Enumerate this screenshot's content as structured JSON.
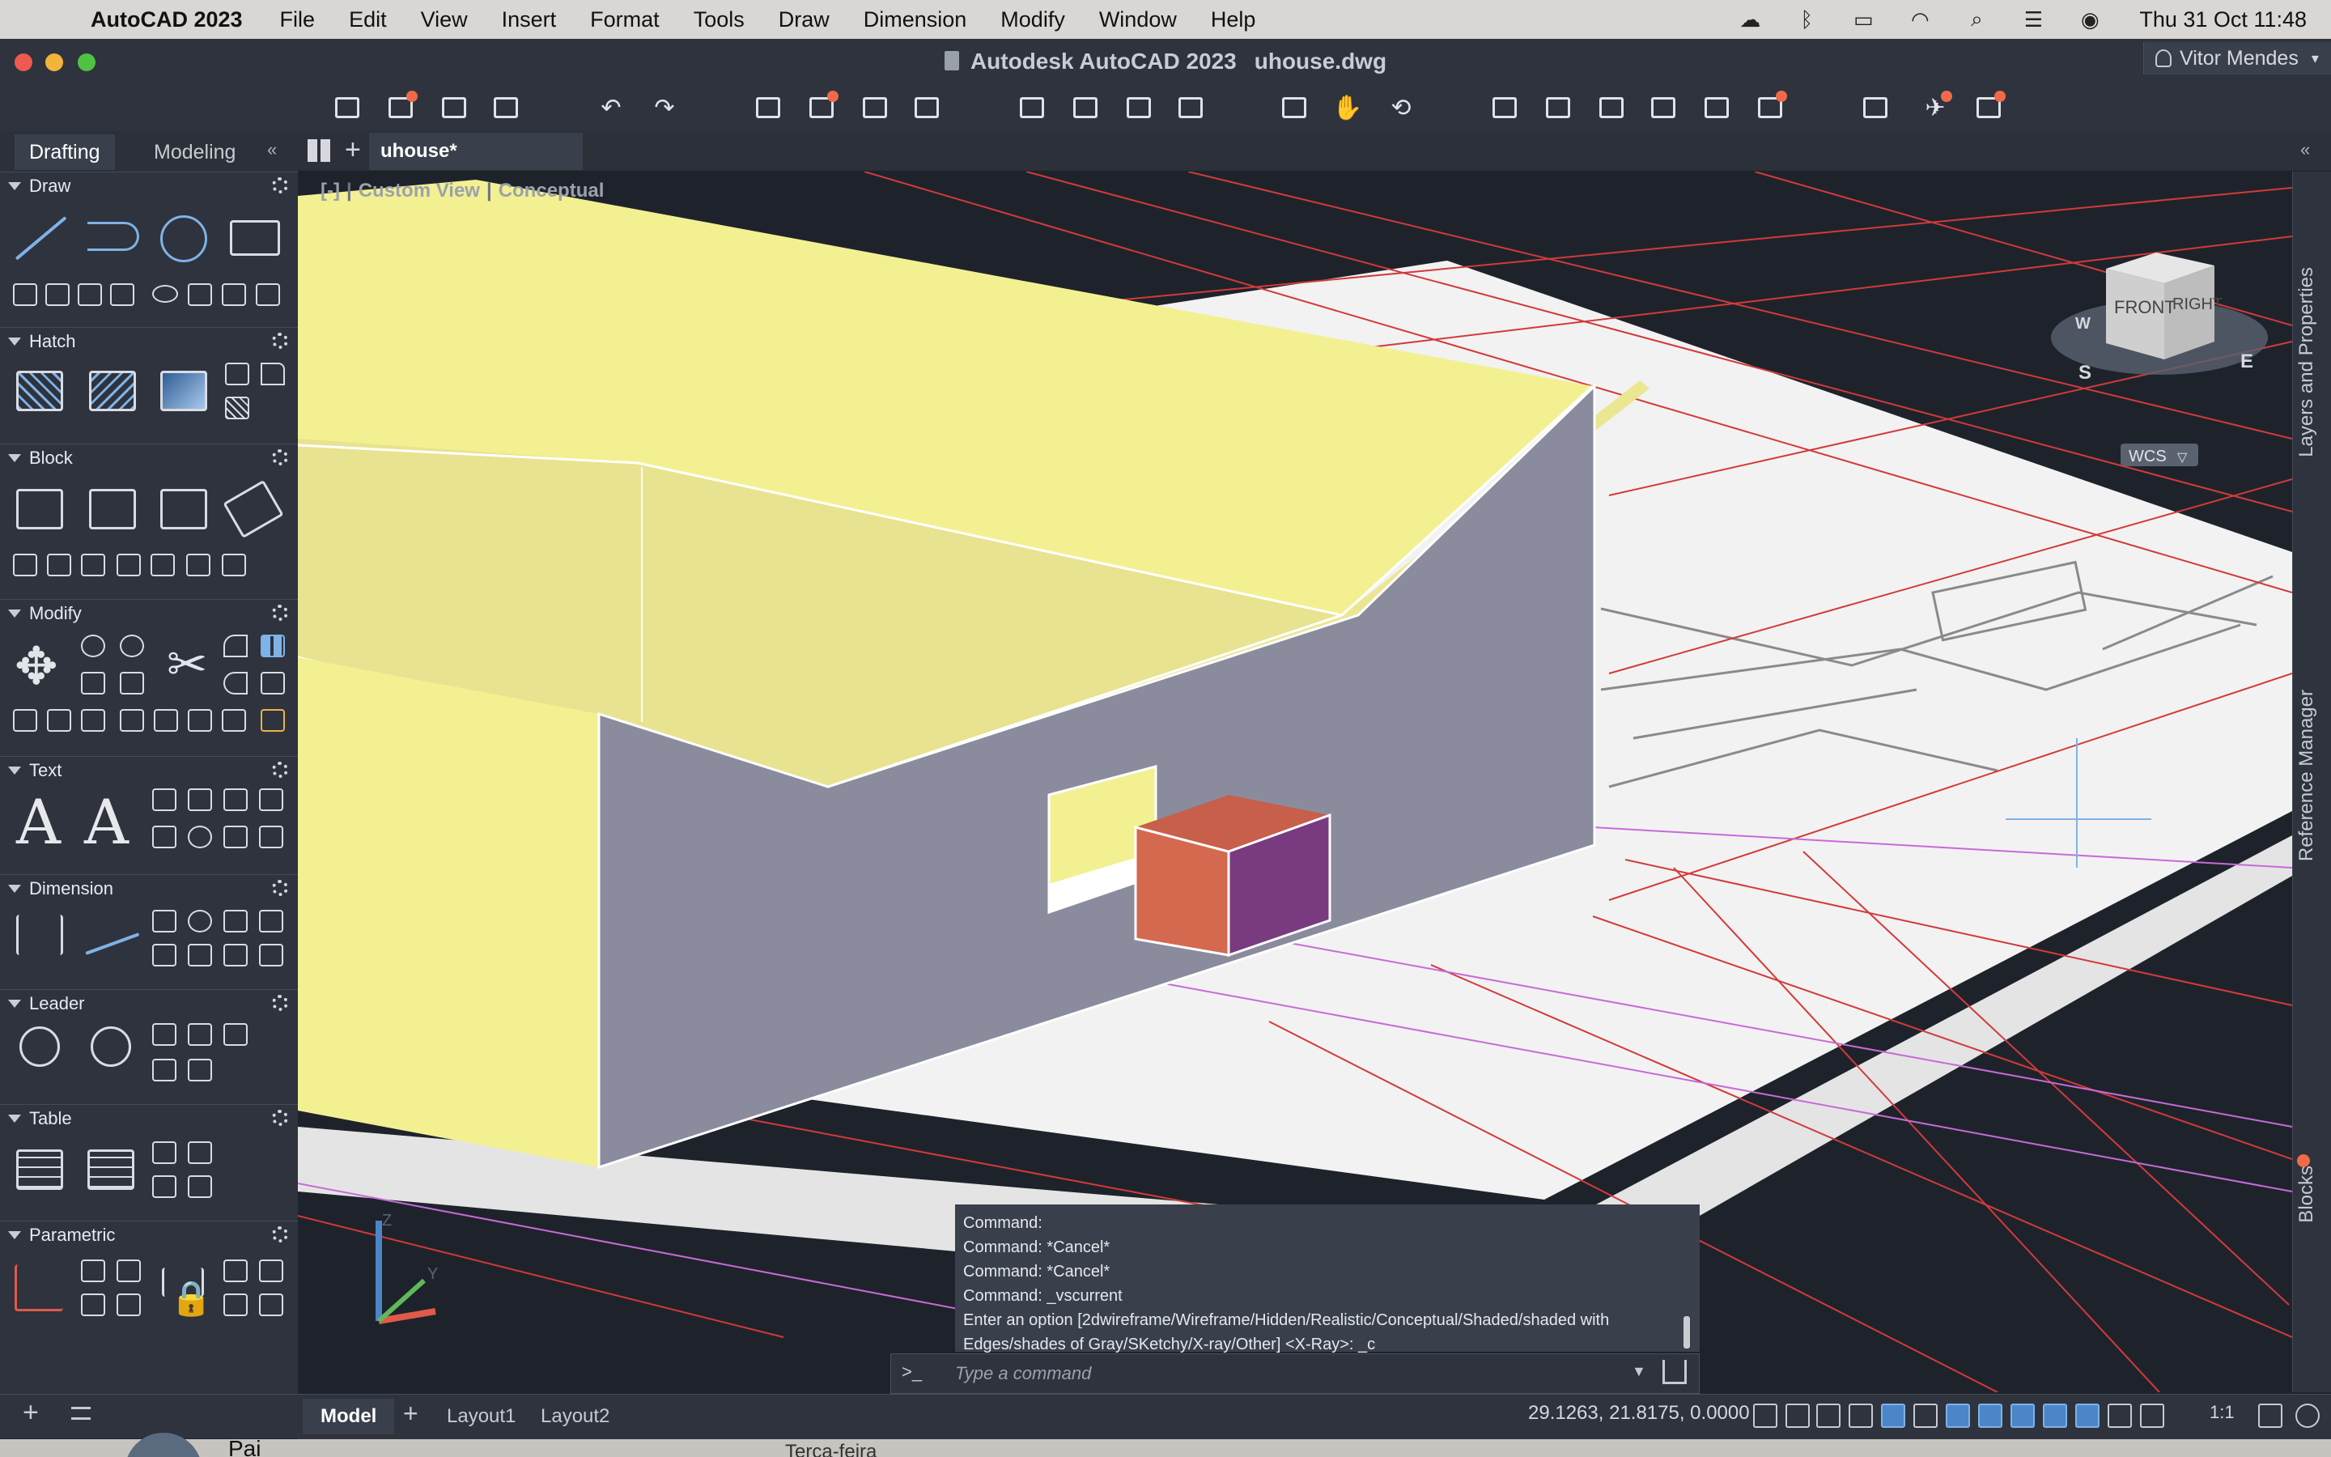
{
  "menubar": {
    "app_name": "AutoCAD 2023",
    "items": [
      "File",
      "Edit",
      "View",
      "Insert",
      "Format",
      "Tools",
      "Draw",
      "Dimension",
      "Modify",
      "Window",
      "Help"
    ],
    "clock": "Thu 31 Oct  11:48",
    "status_icons": [
      "creative-cloud-icon",
      "bluetooth-icon",
      "battery-icon",
      "wifi-icon",
      "spotlight-search-icon",
      "control-center-icon",
      "siri-icon"
    ]
  },
  "window": {
    "title": "Autodesk AutoCAD 2023",
    "filename": "uhouse.dwg",
    "user": "Vitor Mendes"
  },
  "palette": {
    "tabs": [
      "Drafting",
      "Modeling"
    ],
    "active_tab": "Drafting",
    "sections": [
      "Draw",
      "Hatch",
      "Block",
      "Modify",
      "Text",
      "Dimension",
      "Leader",
      "Table",
      "Parametric"
    ],
    "text_glyph": "A"
  },
  "filetab": {
    "name": "uhouse*"
  },
  "viewport": {
    "view_label": "Custom View",
    "style_label": "Conceptual",
    "viewcube": {
      "front": "FRONT",
      "right": "RIGHT",
      "compass_s": "S",
      "compass_e": "E",
      "compass_w": "W"
    },
    "ucs_label": "WCS",
    "axis_z": "Z",
    "axis_y": "Y"
  },
  "right_panels": [
    "Layers and Properties",
    "Reference Manager",
    "Blocks"
  ],
  "command": {
    "history": [
      "Command:",
      "Command: *Cancel*",
      "Command: *Cancel*",
      "Command: _vscurrent",
      "Enter an option [2dwireframe/Wireframe/Hidden/Realistic/Conceptual/Shaded/shaded with",
      "Edges/shades of Gray/SKetchy/X-ray/Other] <X-Ray>: _c"
    ],
    "prompt": ">_",
    "placeholder": "Type a command"
  },
  "status": {
    "layout_tabs": [
      "Model",
      "Layout1",
      "Layout2"
    ],
    "active_layout": "Model",
    "coords": "29.1263, 21.8175, 0.0000",
    "scale": "1:1"
  },
  "dock": {
    "name": "Pai",
    "day": "Terça-feira"
  },
  "colors": {
    "roof": "#f3f092",
    "wall": "#8a8c9e",
    "box_front": "#d4694f",
    "box_side": "#7a3a80",
    "redline": "#d23a3a",
    "accent_blue": "#4a86c8"
  }
}
